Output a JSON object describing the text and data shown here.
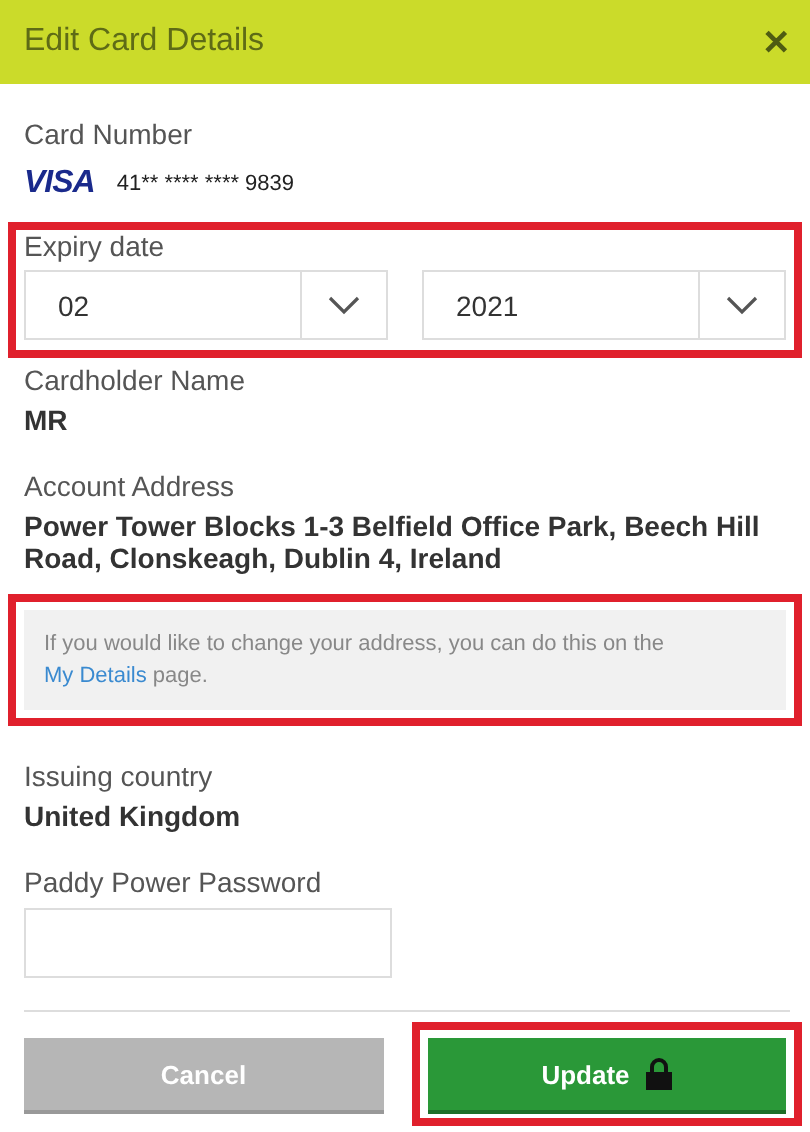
{
  "dialog": {
    "title": "Edit Card Details",
    "close": "✕"
  },
  "card_number": {
    "label": "Card Number",
    "brand": "VISA",
    "number": "41** **** **** 9839"
  },
  "expiry": {
    "label": "Expiry date",
    "highlighted": true,
    "month": "02",
    "year": "2021"
  },
  "cardholder": {
    "label": "Cardholder Name",
    "value": "MR"
  },
  "address": {
    "label": "Account Address",
    "value": "Power Tower Blocks 1-3 Belfield Office Park, Beech Hill Road, Clonskeagh, Dublin 4, Ireland"
  },
  "address_note": {
    "highlighted": true,
    "text": "If you would like to change your address, you can do this on the",
    "link": "My Details",
    "after": "page."
  },
  "issuing_country": {
    "label": "Issuing country",
    "value": "United Kingdom"
  },
  "password": {
    "label": "Paddy Power Password"
  },
  "buttons": [
    {
      "kind": "cancel",
      "label": "Cancel",
      "highlighted": false
    },
    {
      "kind": "update",
      "label": "Update",
      "highlighted": true
    }
  ]
}
